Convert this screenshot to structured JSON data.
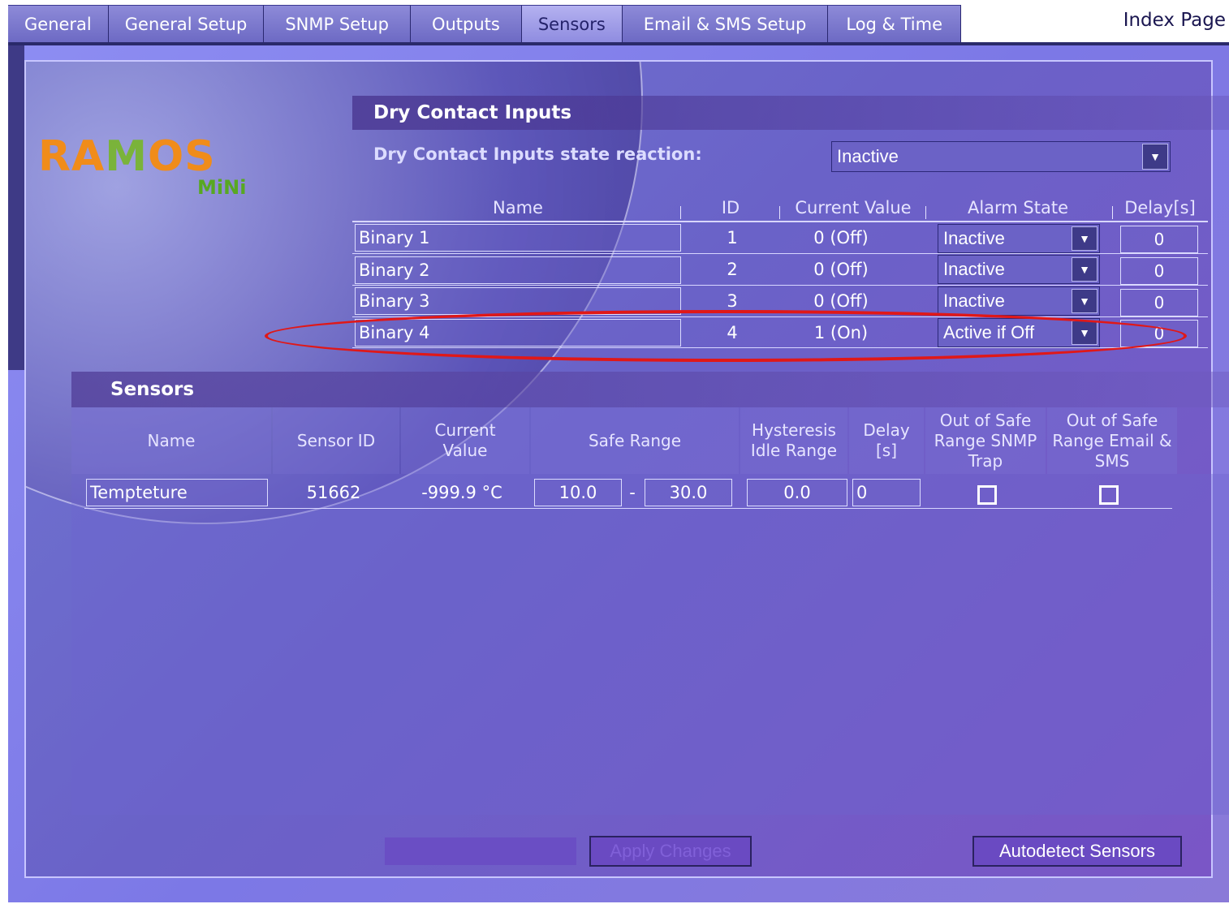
{
  "tabs": [
    {
      "label": "General"
    },
    {
      "label": "General Setup"
    },
    {
      "label": "SNMP Setup"
    },
    {
      "label": "Outputs"
    },
    {
      "label": "Sensors",
      "active": true
    },
    {
      "label": "Email & SMS Setup"
    },
    {
      "label": "Log & Time"
    }
  ],
  "index_link": "Index Page",
  "logo": {
    "main": "RAMOS",
    "sub": "MiNi"
  },
  "dry_contact": {
    "title": "Dry Contact Inputs",
    "reaction_label": "Dry Contact Inputs state reaction:",
    "reaction_value": "Inactive",
    "headers": {
      "name": "Name",
      "id": "ID",
      "current_value": "Current Value",
      "alarm_state": "Alarm State",
      "delay": "Delay[s]"
    },
    "rows": [
      {
        "name": "Binary 1",
        "id": "1",
        "current_value": "0 (Off)",
        "alarm_state": "Inactive",
        "delay": "0"
      },
      {
        "name": "Binary 2",
        "id": "2",
        "current_value": "0 (Off)",
        "alarm_state": "Inactive",
        "delay": "0"
      },
      {
        "name": "Binary 3",
        "id": "3",
        "current_value": "0 (Off)",
        "alarm_state": "Inactive",
        "delay": "0"
      },
      {
        "name": "Binary 4",
        "id": "4",
        "current_value": "1 (On)",
        "alarm_state": "Active if Off",
        "delay": "0"
      }
    ]
  },
  "sensors": {
    "title": "Sensors",
    "headers": {
      "name": "Name",
      "sensor_id": "Sensor ID",
      "current_value": "Current Value",
      "safe_range": "Safe Range",
      "hysteresis": "Hysteresis Idle Range",
      "delay": "Delay [s]",
      "snmp_trap": "Out of Safe Range SNMP Trap",
      "email_sms": "Out of Safe Range Email & SMS"
    },
    "rows": [
      {
        "name": "Tempteture",
        "sensor_id": "51662",
        "current_value": "-999.9 °C",
        "range_low": "10.0",
        "range_sep": "-",
        "range_high": "30.0",
        "hysteresis": "0.0",
        "delay": "0",
        "snmp_trap": false,
        "email_sms": false
      }
    ]
  },
  "buttons": {
    "apply": "Apply Changes",
    "autodetect": "Autodetect Sensors"
  },
  "colors": {
    "highlight_ring": "#e01818",
    "panel": "#6a62c8",
    "logo_orange": "#f08c1a",
    "logo_green": "#7ab33a"
  }
}
